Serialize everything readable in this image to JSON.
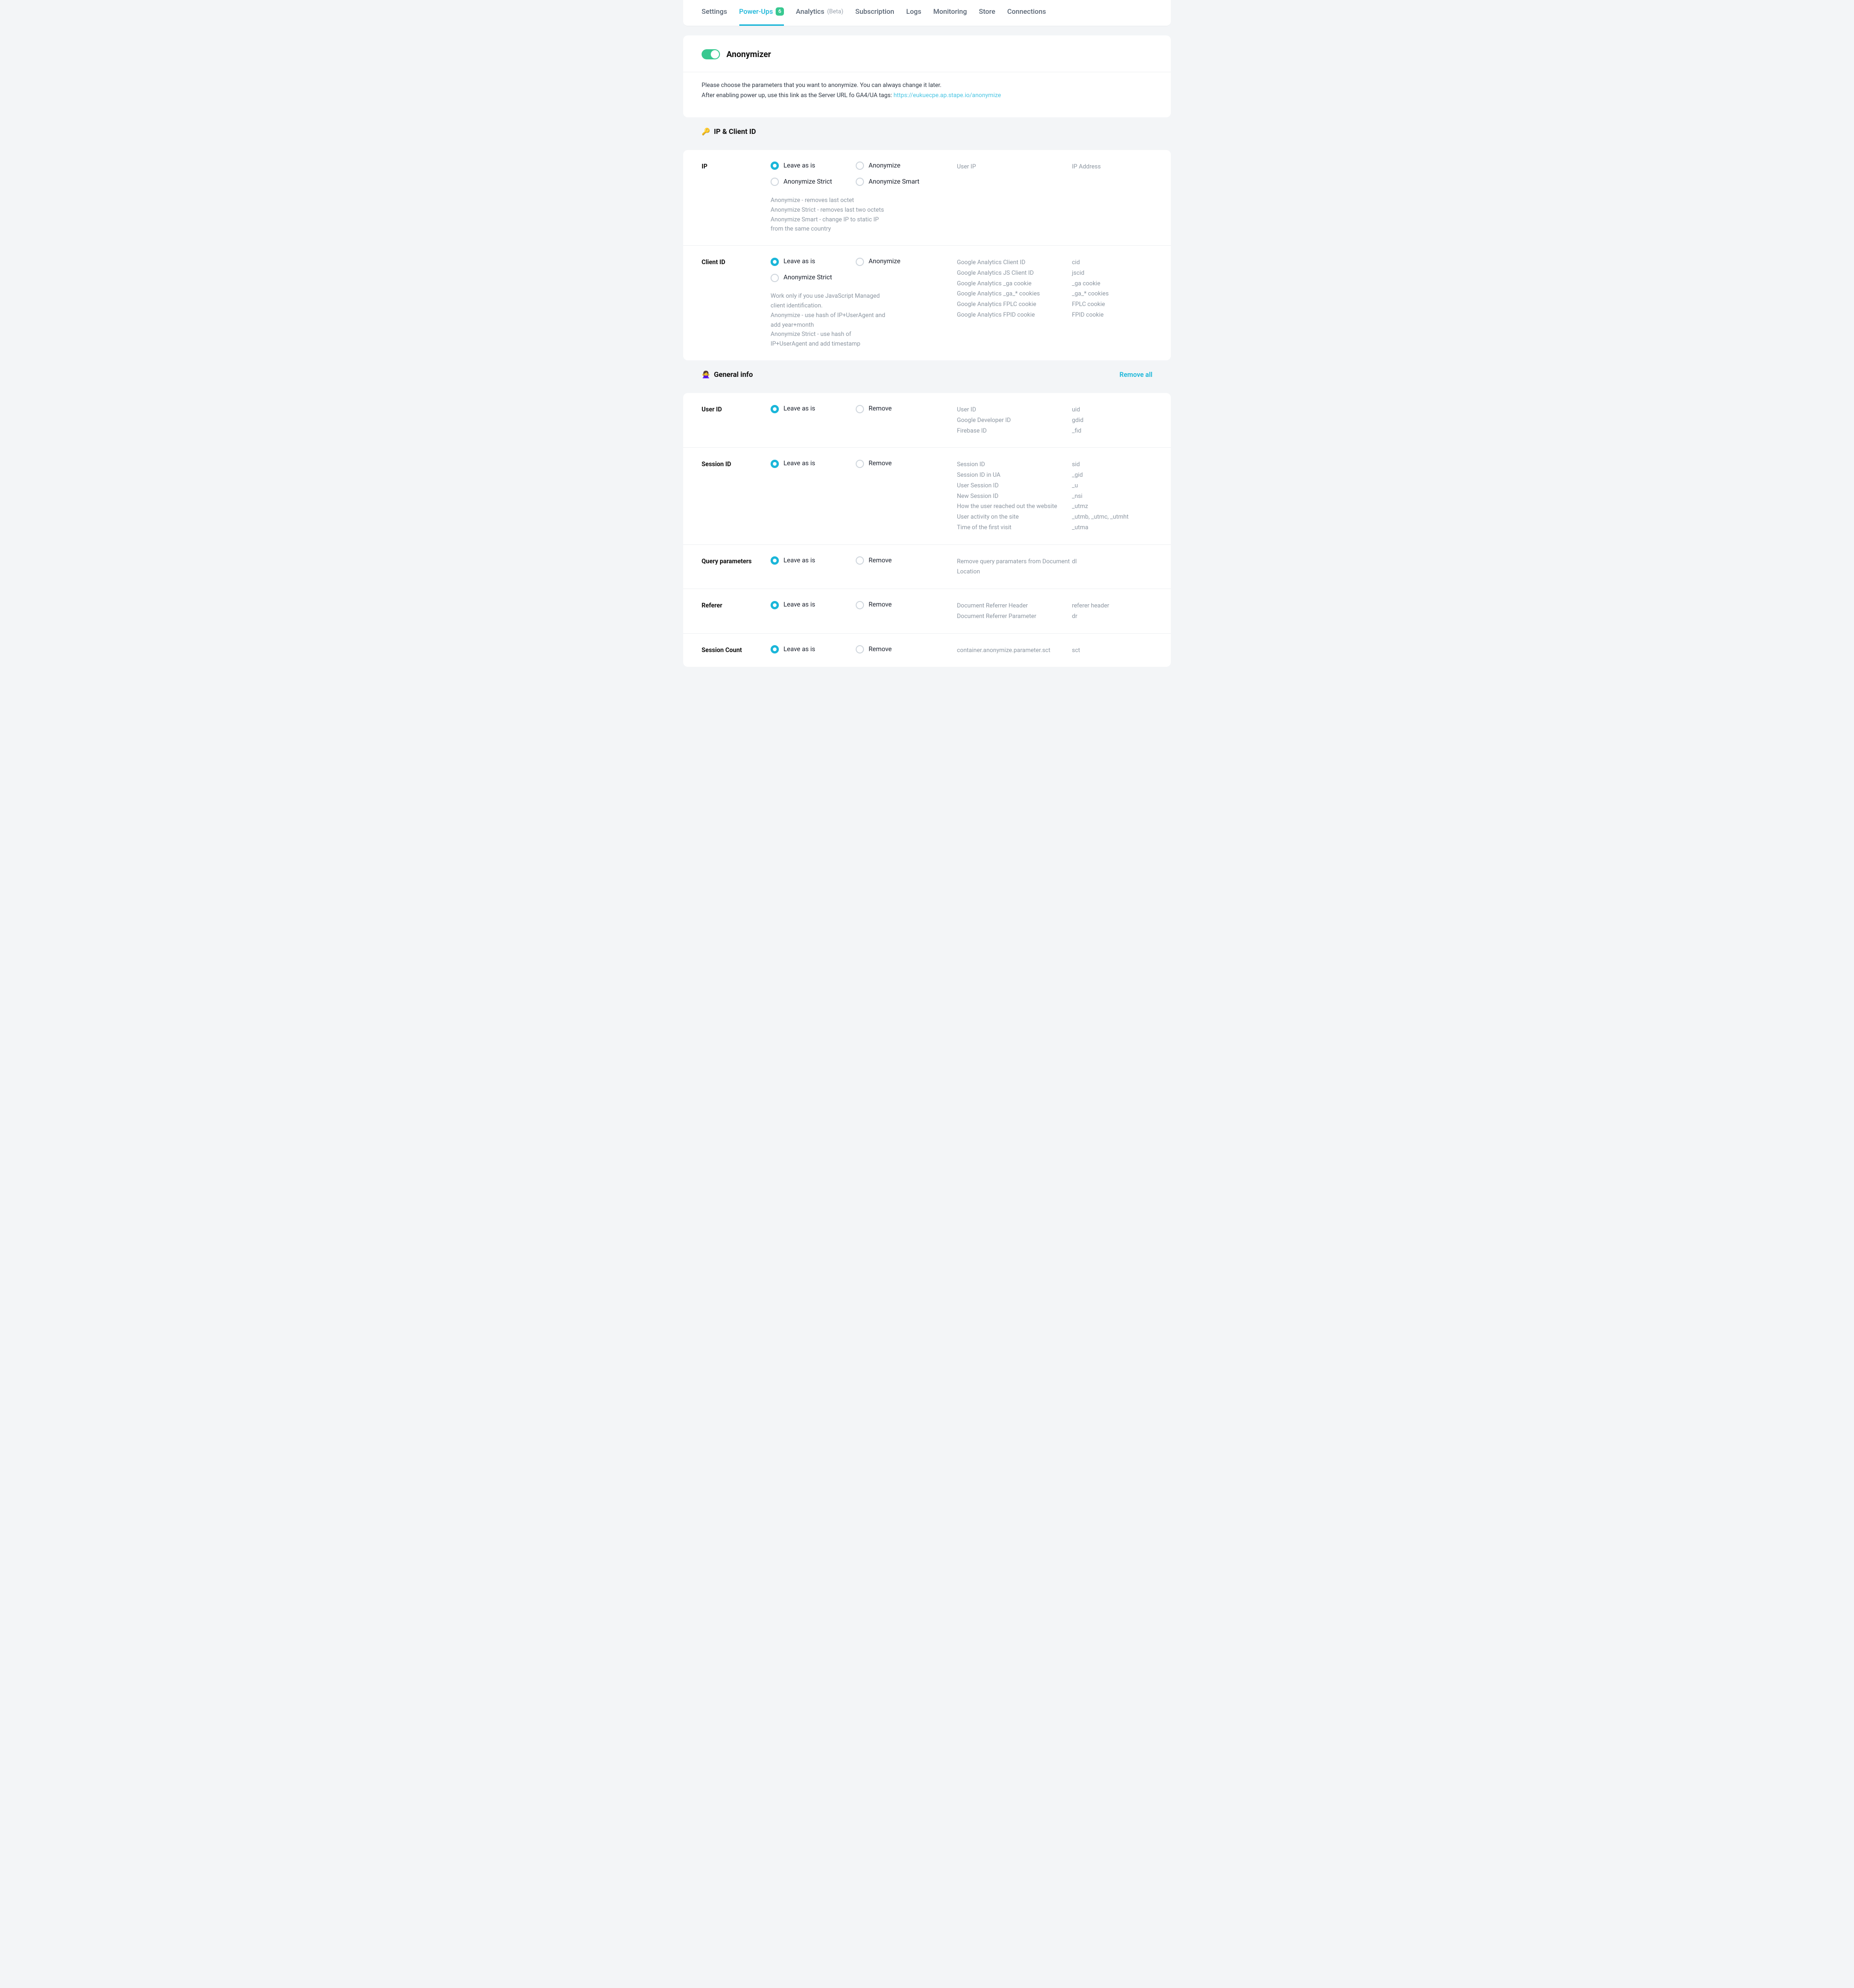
{
  "tabs": {
    "settings": "Settings",
    "powerups": "Power-Ups",
    "powerups_badge": "6",
    "analytics": "Analytics",
    "analytics_beta": "(Beta)",
    "subscription": "Subscription",
    "logs": "Logs",
    "monitoring": "Monitoring",
    "store": "Store",
    "connections": "Connections"
  },
  "header": {
    "title": "Anonymizer",
    "info_line1": "Please choose the parameters that you want to anonymize. You can always change it later.",
    "info_line2_pre": "After enabling power up, use this link as the Server URL fo GA4/UA tags: ",
    "info_link": "https://eukuecpe.ap.stape.io/anonymize"
  },
  "sections": {
    "ip_client": {
      "emoji": "🔑",
      "title": "IP & Client ID"
    },
    "general": {
      "emoji": "🙅‍♀️",
      "title": "General info",
      "remove_all": "Remove all"
    }
  },
  "opts": {
    "leave": "Leave as is",
    "anonymize": "Anonymize",
    "anon_strict": "Anonymize Strict",
    "anon_smart": "Anonymize Smart",
    "remove": "Remove"
  },
  "rows": {
    "ip": {
      "label": "IP",
      "help": "Anonymize - removes last octet\nAnonymize Strict - removes last two octets\nAnonymize Smart - change IP to static IP from the same country",
      "info": [
        "User IP"
      ],
      "code": [
        "IP Address"
      ]
    },
    "client_id": {
      "label": "Client ID",
      "help": "Work only if you use JavaScript Managed client identification.\nAnonymize - use hash of IP+UserAgent and add year+month\nAnonymize Strict - use hash of IP+UserAgent and add timestamp",
      "info": [
        "Google Analytics Client ID",
        "Google Analytics JS Client ID",
        "Google Analytics _ga cookie",
        "Google Analytics _ga_* cookies",
        "Google Analytics FPLC cookie",
        "Google Analytics FPID cookie"
      ],
      "code": [
        "cid",
        "jscid",
        "_ga cookie",
        "_ga_* cookies",
        "FPLC cookie",
        "FPID cookie"
      ]
    },
    "user_id": {
      "label": "User ID",
      "info": [
        "User ID",
        "Google Developer ID",
        "Firebase ID"
      ],
      "code": [
        "uid",
        "gdid",
        "_fid"
      ]
    },
    "session_id": {
      "label": "Session ID",
      "info": [
        "Session ID",
        "Session ID in UA",
        "User Session ID",
        "New Session ID",
        "How the user reached out the website",
        "User activity on the site",
        "Time of the first visit"
      ],
      "code": [
        "sid",
        "_gid",
        "_u",
        "_nsi",
        "_utmz",
        "_utmb, _utmc, _utmht",
        "_utma"
      ]
    },
    "query_params": {
      "label": "Query parameters",
      "info": [
        "Remove query paramaters from Document Location"
      ],
      "code": [
        "dl"
      ]
    },
    "referer": {
      "label": "Referer",
      "info": [
        "Document Referrer Header",
        "Document Referrer Parameter"
      ],
      "code": [
        "referer header",
        "dr"
      ]
    },
    "session_count": {
      "label": "Session Count",
      "info": [
        "container.anonymize.parameter.sct"
      ],
      "code": [
        "sct"
      ]
    }
  }
}
